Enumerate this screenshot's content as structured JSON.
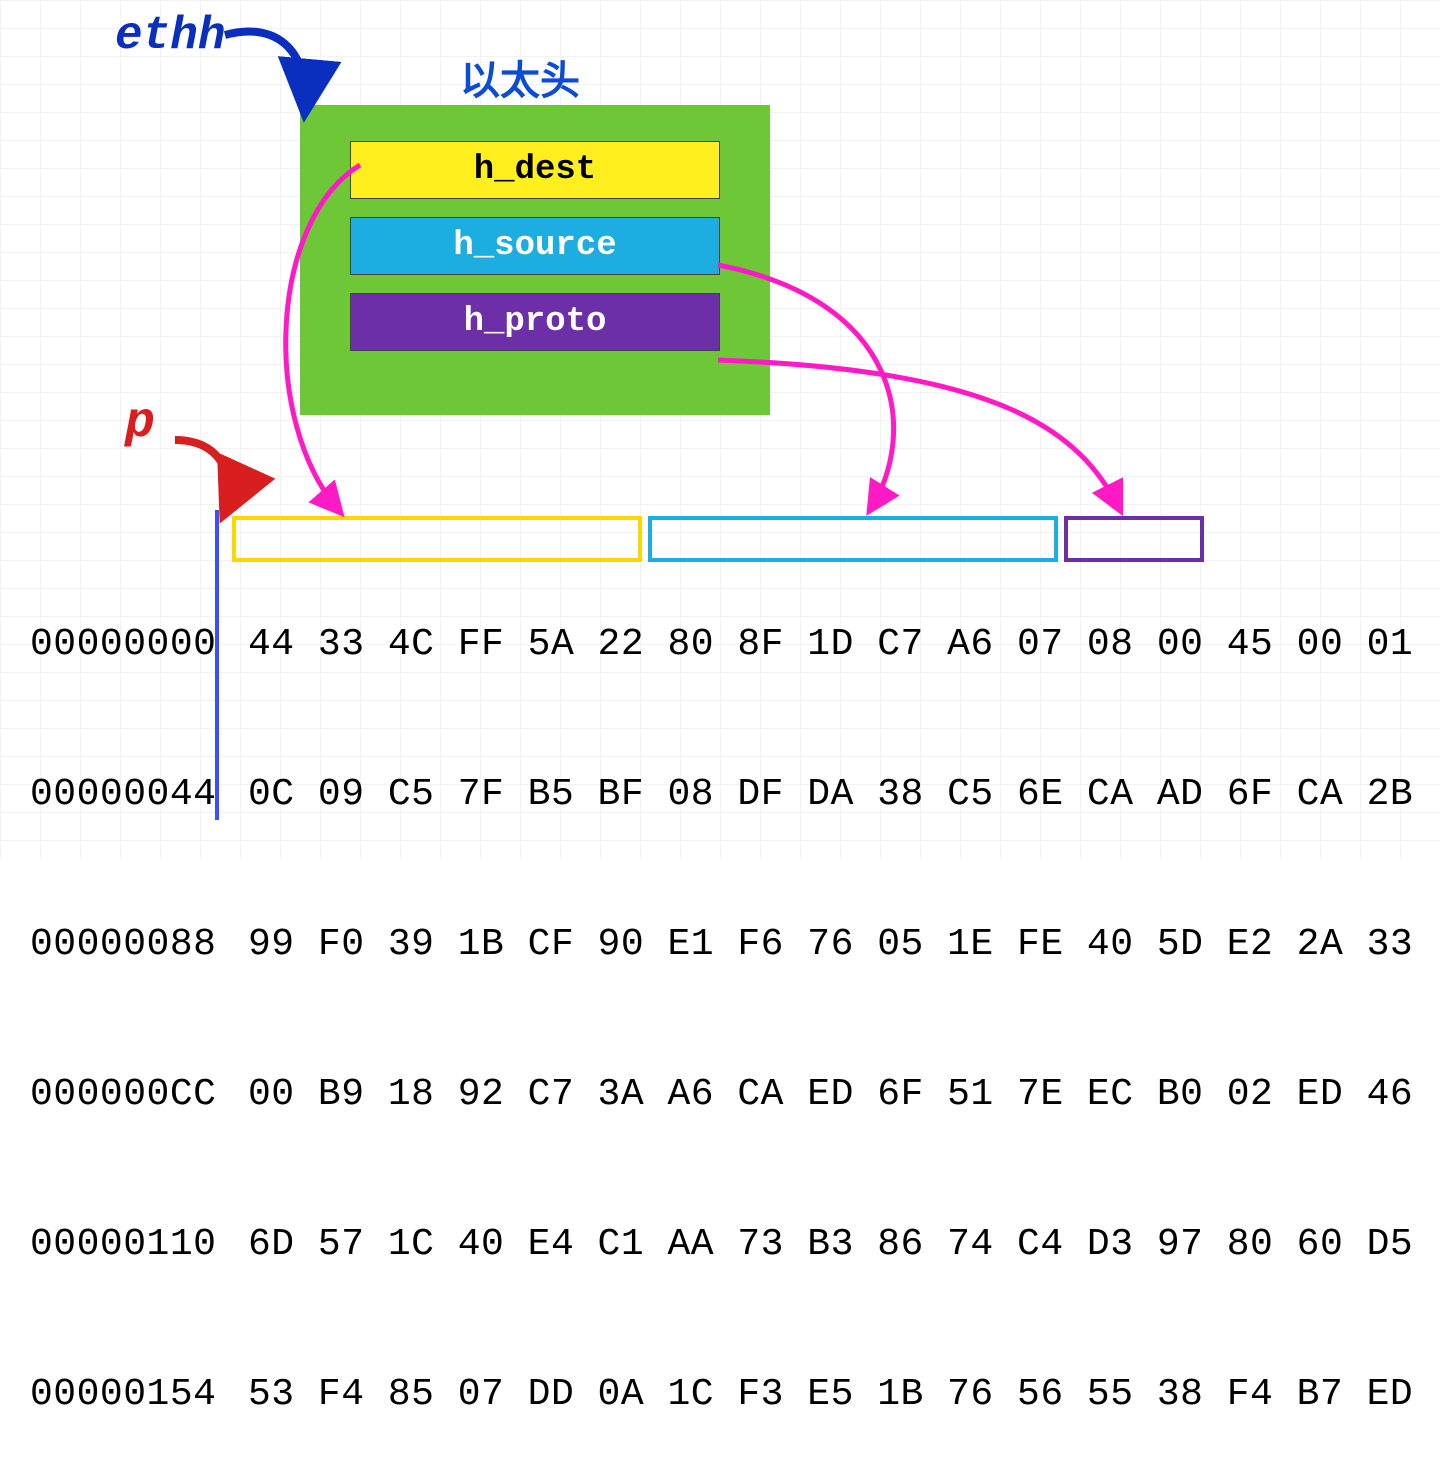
{
  "labels": {
    "ethh": "ethh",
    "p": "p",
    "eth_header_title": "以太头"
  },
  "fields": {
    "h_dest": "h_dest",
    "h_source": "h_source",
    "h_proto": "h_proto"
  },
  "colors": {
    "h_dest_bg": "#ffef1f",
    "h_source_bg": "#1caee0",
    "h_proto_bg": "#6c2fa8",
    "eth_box_bg": "#6ec737",
    "ethh_label": "#0a2fc0",
    "p_label": "#d81e1e",
    "title": "#0a4bd8",
    "arrow_magenta": "#ff1ac6",
    "arrow_blue": "#0a2fc0",
    "arrow_red": "#d81e1e"
  },
  "hex": {
    "rows": [
      {
        "offset": "00000000",
        "bytes": "44 33 4C FF 5A 22 80 8F 1D C7 A6 07 08 00 45 00 01"
      },
      {
        "offset": "00000044",
        "bytes": "0C 09 C5 7F B5 BF 08 DF DA 38 C5 6E CA AD 6F CA 2B"
      },
      {
        "offset": "00000088",
        "bytes": "99 F0 39 1B CF 90 E1 F6 76 05 1E FE 40 5D E2 2A 33"
      },
      {
        "offset": "000000CC",
        "bytes": "00 B9 18 92 C7 3A A6 CA ED 6F 51 7E EC B0 02 ED 46"
      },
      {
        "offset": "00000110",
        "bytes": "6D 57 1C 40 E4 C1 AA 73 B3 86 74 C4 D3 97 80 60 D5"
      },
      {
        "offset": "00000154",
        "bytes": "53 F4 85 07 DD 0A 1C F3 E5 1B 76 56 55 38 F4 B7 ED"
      }
    ],
    "highlights": {
      "h_dest_bytes": "44 33 4C FF 5A 22",
      "h_source_bytes": "80 8F 1D C7 A6 07",
      "h_proto_bytes": "08 00"
    }
  }
}
